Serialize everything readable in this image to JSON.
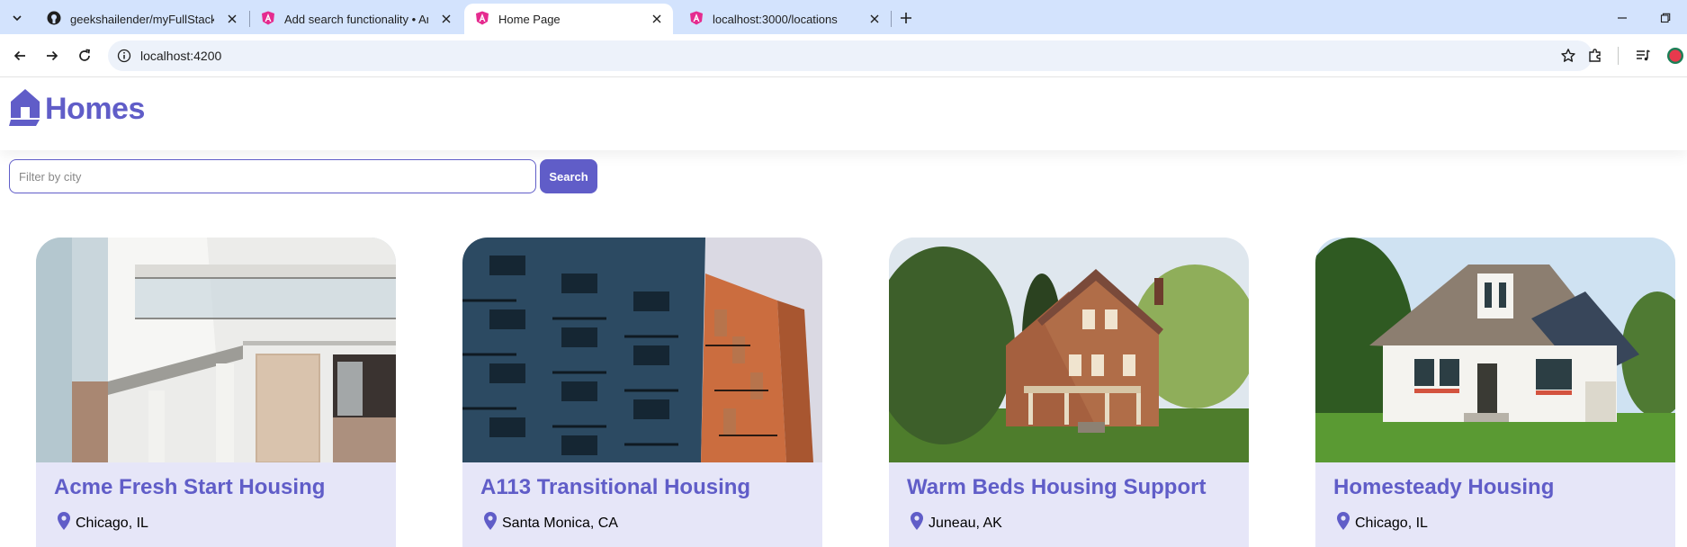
{
  "browser": {
    "tabs": [
      {
        "title": "geekshailender/myFullStackApp",
        "favicon": "github-icon"
      },
      {
        "title": "Add search functionality • Angular",
        "favicon": "angular-icon"
      },
      {
        "title": "Home Page",
        "favicon": "angular-icon",
        "active": true
      },
      {
        "title": "localhost:3000/locations",
        "favicon": "angular-icon"
      }
    ],
    "url": "localhost:4200",
    "colors": {
      "chrome": "#d3e3fd",
      "omnibox": "#edf2fa",
      "profile": "#e8394d"
    }
  },
  "app": {
    "brand": "Homes",
    "brand_color": "#605dc8",
    "search": {
      "placeholder": "Filter by city",
      "button_label": "Search"
    },
    "listings": [
      {
        "name": "Acme Fresh Start Housing",
        "location": "Chicago, IL",
        "image": "white-modern-apartment-balconies"
      },
      {
        "name": "A113 Transitional Housing",
        "location": "Santa Monica, CA",
        "image": "blue-orange-apartment-tower"
      },
      {
        "name": "Warm Beds Housing Support",
        "location": "Juneau, AK",
        "image": "victorian-brick-house"
      },
      {
        "name": "Homesteady Housing",
        "location": "Chicago, IL",
        "image": "white-suburban-cottage"
      }
    ],
    "card_color": "#e6e6f8"
  }
}
